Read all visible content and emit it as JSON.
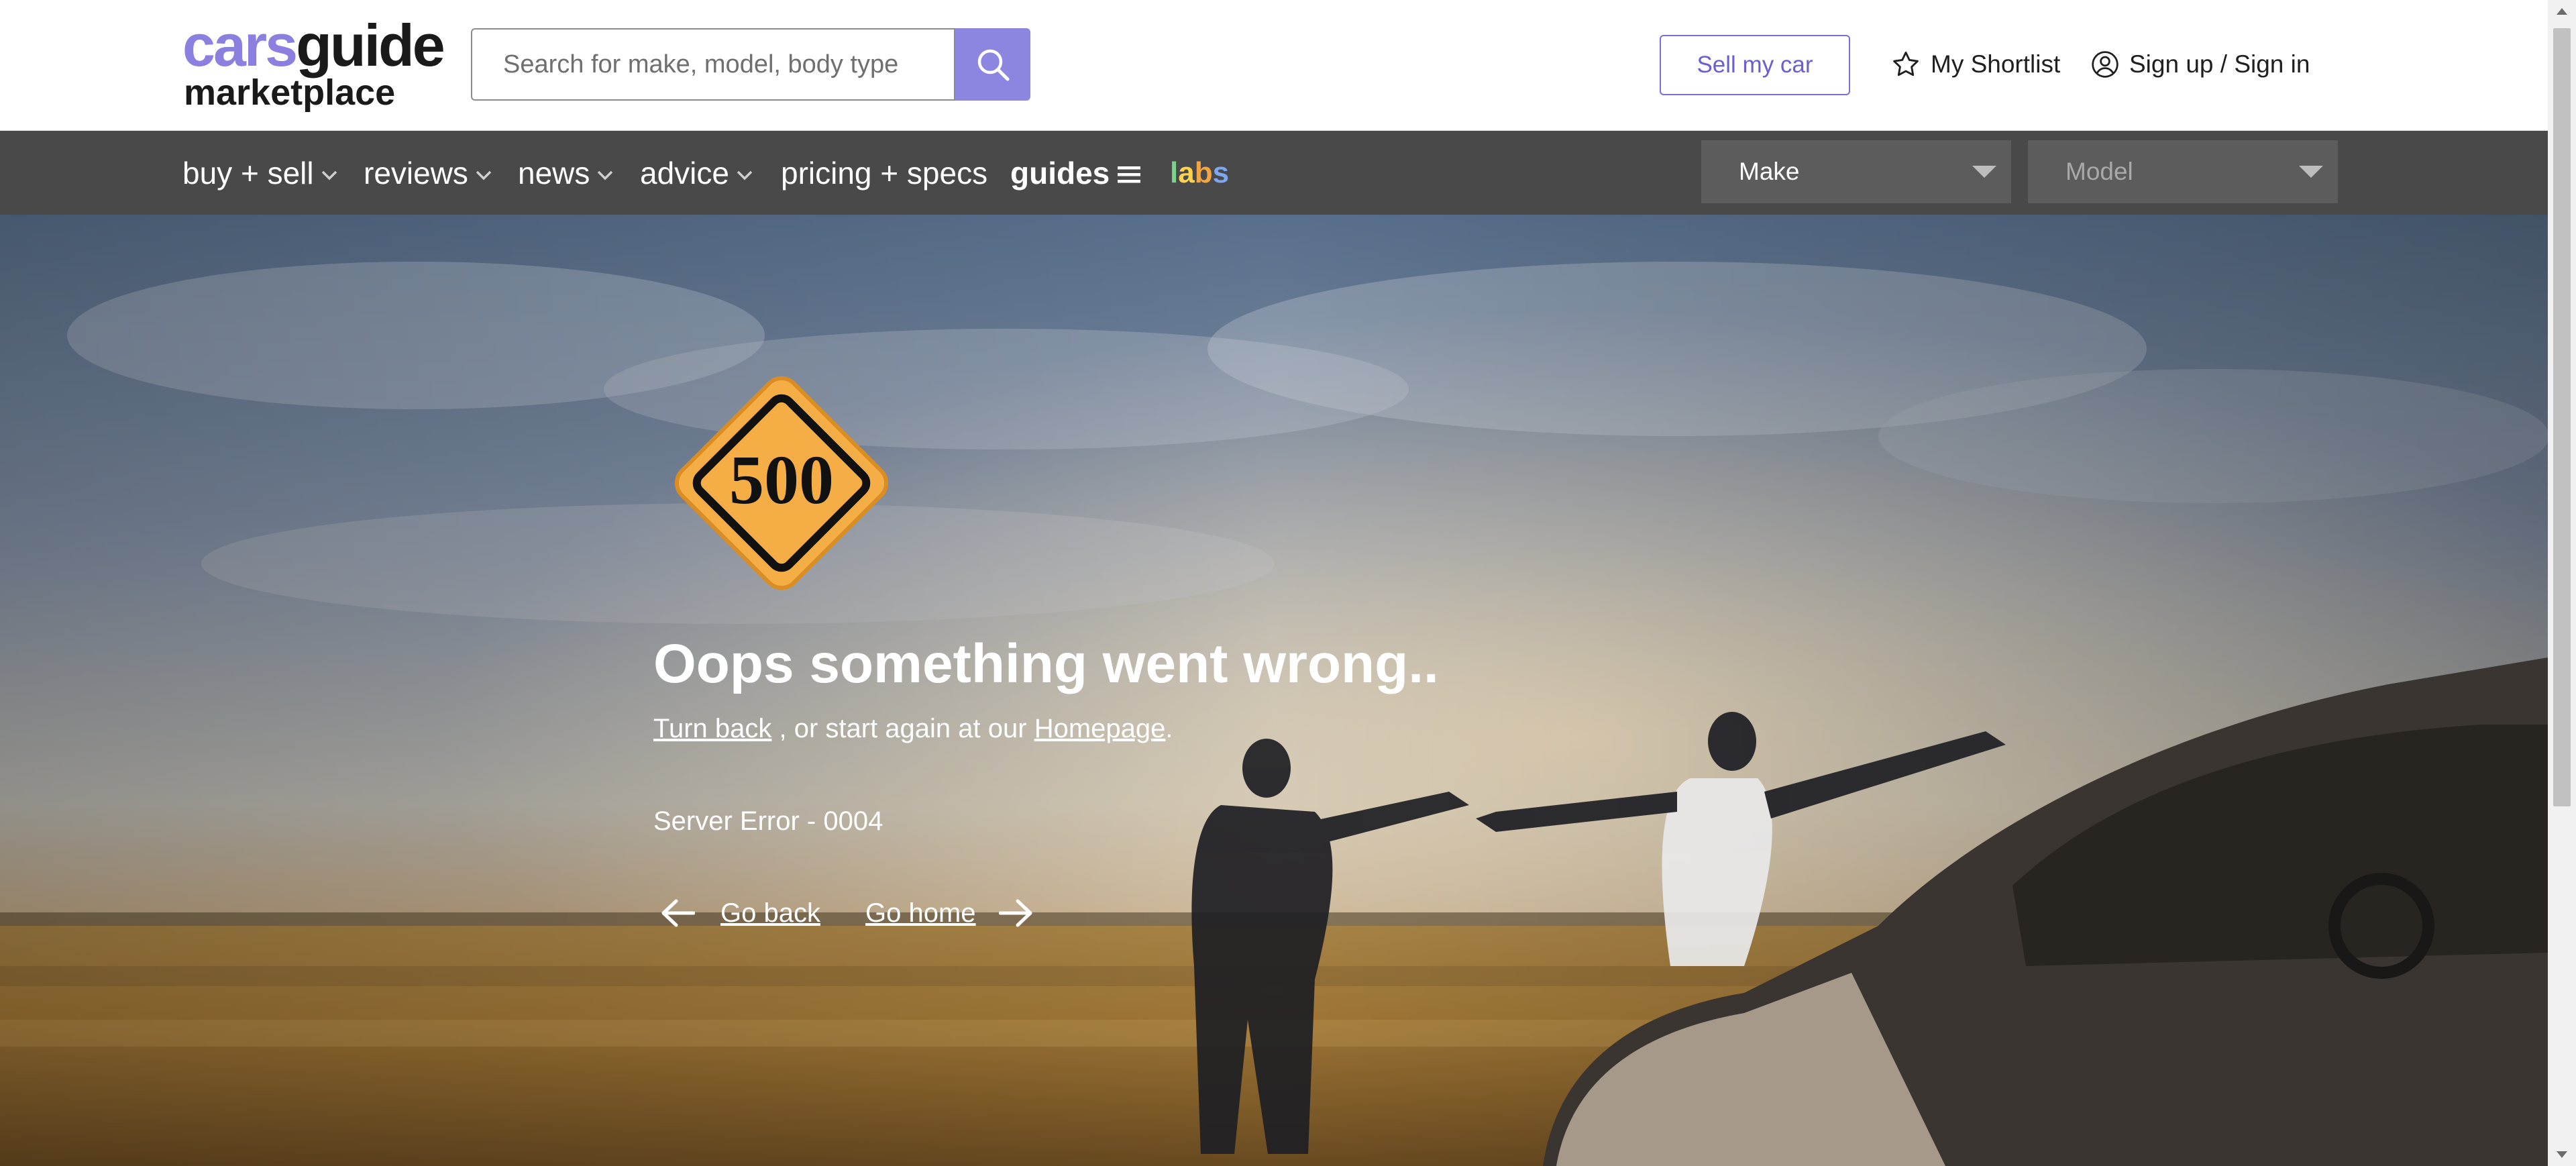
{
  "header": {
    "logo_top_a": "cars",
    "logo_top_b": "guide",
    "logo_bottom": "marketplace",
    "search_placeholder": "Search for make, model, body type",
    "sell_button": "Sell my car",
    "shortlist": "My Shortlist",
    "signin": "Sign up / Sign in"
  },
  "nav": {
    "items": [
      {
        "label": "buy + sell",
        "has_dropdown": true
      },
      {
        "label": "reviews",
        "has_dropdown": true
      },
      {
        "label": "news",
        "has_dropdown": true
      },
      {
        "label": "advice",
        "has_dropdown": true
      },
      {
        "label": "pricing + specs",
        "has_dropdown": false
      },
      {
        "label": "guides",
        "has_dropdown": false
      }
    ],
    "labs": [
      "l",
      "a",
      "b",
      "s"
    ],
    "make_select": "Make",
    "model_select": "Model"
  },
  "error": {
    "sign_number": "500",
    "title": "Oops something went wrong..",
    "turn_back": "Turn back",
    "middle_text": " , or start again at our ",
    "homepage": "Homepage",
    "period": ".",
    "server_error": "Server Error - 0004",
    "go_back": "Go back",
    "go_home": "Go home"
  },
  "colors": {
    "brand_purple": "#8b7fe0",
    "nav_background": "#494949",
    "warning_sign": "#f5ae45"
  },
  "icons": [
    "search-icon",
    "star-icon",
    "user-circle-icon",
    "chevron-down-icon",
    "hamburger-icon",
    "arrow-left-icon",
    "arrow-right-icon",
    "caret-down-icon"
  ]
}
